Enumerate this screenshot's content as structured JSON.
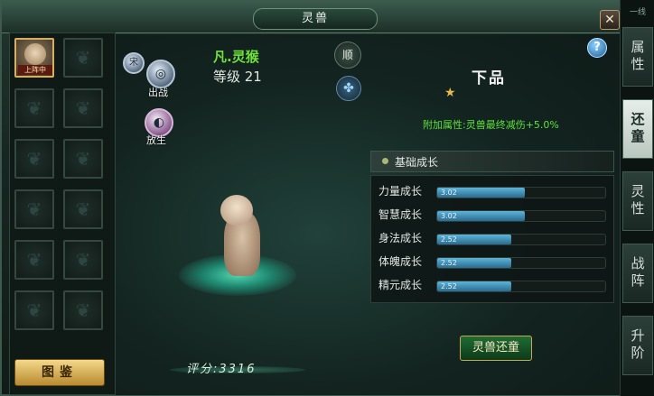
{
  "window": {
    "title": "灵兽",
    "close_label": "✕"
  },
  "side_top_label": "一线",
  "tabs": [
    {
      "label": "属性",
      "active": false
    },
    {
      "label": "还童",
      "active": true
    },
    {
      "label": "灵性",
      "active": false
    },
    {
      "label": "战阵",
      "active": false
    },
    {
      "label": "升阶",
      "active": false
    }
  ],
  "slots": {
    "active_tag": "上阵中",
    "total": 12
  },
  "tujian_label": "图鉴",
  "pet": {
    "name": "凡.灵猴",
    "level": "等级 21",
    "grade": "下品",
    "stars": 1,
    "bonus": "附加属性:灵兽最终减伤+5.0%"
  },
  "actions": {
    "chuzhan": "出战",
    "fangsheng": "放生",
    "shun": "顺",
    "feed": "宋"
  },
  "growth": {
    "title": "基础成长",
    "stats": [
      {
        "name": "力量成长",
        "value": "3.02",
        "fill": 0.52
      },
      {
        "name": "智慧成长",
        "value": "3.02",
        "fill": 0.52
      },
      {
        "name": "身法成长",
        "value": "2.52",
        "fill": 0.44
      },
      {
        "name": "体魄成长",
        "value": "2.52",
        "fill": 0.44
      },
      {
        "name": "精元成长",
        "value": "2.52",
        "fill": 0.44
      }
    ]
  },
  "huantong_label": "灵兽还童",
  "score": "评分:3316",
  "help_label": "?"
}
